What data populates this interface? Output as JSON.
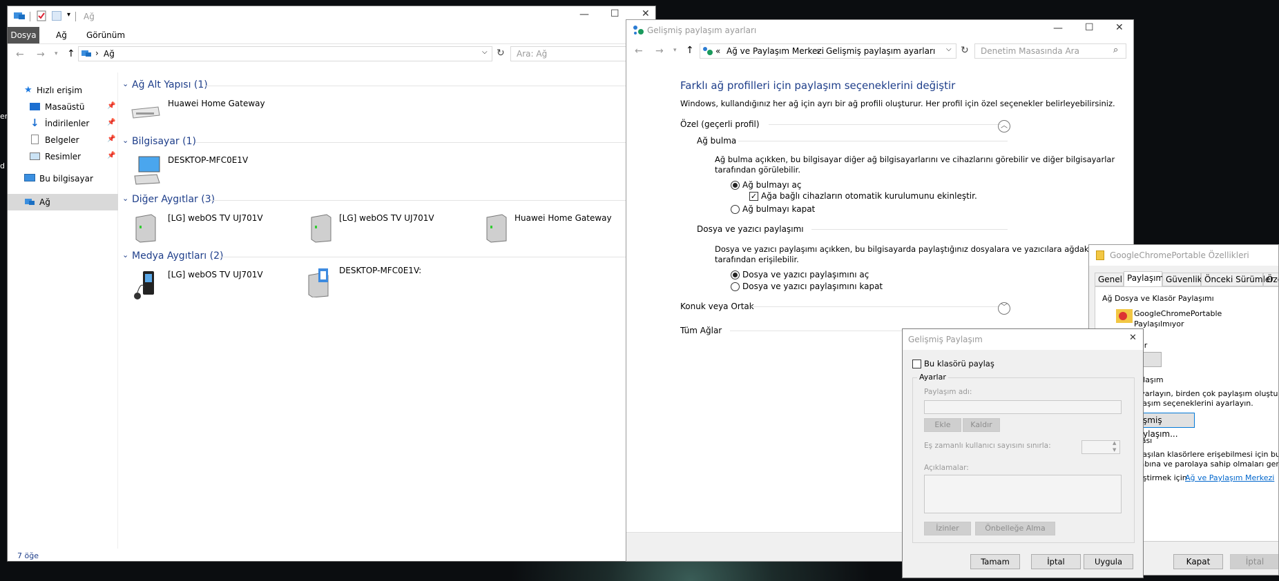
{
  "desktop": {
    "edge_glyphs": [
      "er",
      "d"
    ]
  },
  "explorer": {
    "title": "Ağ",
    "ribbon_tabs": [
      "Dosya",
      "Ağ",
      "Görünüm"
    ],
    "address": "Ağ",
    "search_placeholder": "Ara: Ağ",
    "nav": {
      "quick_access": "Hızlı erişim",
      "items": [
        "Masaüstü",
        "İndirilenler",
        "Belgeler",
        "Resimler"
      ],
      "this_pc": "Bu bilgisayar",
      "network": "Ağ"
    },
    "groups": [
      {
        "title": "Ağ Alt Yapısı (1)",
        "items": [
          "Huawei Home Gateway"
        ]
      },
      {
        "title": "Bilgisayar (1)",
        "items": [
          "DESKTOP-MFC0E1V"
        ]
      },
      {
        "title": "Diğer Aygıtlar (3)",
        "items": [
          "[LG] webOS TV UJ701V",
          "[LG] webOS TV UJ701V",
          "Huawei Home Gateway"
        ]
      },
      {
        "title": "Medya Aygıtları (2)",
        "items": [
          "[LG] webOS TV UJ701V",
          "DESKTOP-MFC0E1V:"
        ]
      }
    ],
    "status": "7 öğe"
  },
  "advanced": {
    "title": "Gelişmiş paylaşım ayarları",
    "breadcrumb_prefix": "«",
    "breadcrumb": [
      "Ağ ve Paylaşım Merkezi",
      "Gelişmiş paylaşım ayarları"
    ],
    "search_placeholder": "Denetim Masasında Ara",
    "heading": "Farklı ağ profilleri için paylaşım seçeneklerini değiştir",
    "intro": "Windows, kullandığınız her ağ için ayrı bir ağ profili oluşturur. Her profil için özel seçenekler belirleyebilirsiniz.",
    "profile_private": "Özel (geçerli profil)",
    "discovery_title": "Ağ bulma",
    "discovery_desc_1": "Ağ bulma açıkken, bu bilgisayar diğer ağ bilgisayarlarını ve cihazlarını görebilir ve diğer bilgisayarlar",
    "discovery_desc_2": "tarafından görülebilir.",
    "discovery_on": "Ağ bulmayı aç",
    "discovery_auto": "Ağa bağlı cihazların otomatik kurulumunu ekinleştir.",
    "discovery_off": "Ağ bulmayı kapat",
    "sharing_title": "Dosya ve yazıcı paylaşımı",
    "sharing_desc_1": "Dosya ve yazıcı paylaşımı açıkken, bu bilgisayarda paylaştığınız dosyalara ve yazıcılara ağdaki kişiler",
    "sharing_desc_2": "tarafından erişilebilir.",
    "sharing_on": "Dosya ve yazıcı paylaşımını aç",
    "sharing_off": "Dosya ve yazıcı paylaşımını kapat",
    "profile_guest": "Konuk veya Ortak",
    "profile_all": "Tüm Ağlar"
  },
  "props": {
    "title": "GoogleChromePortable Özellikleri",
    "tabs": [
      "Genel",
      "Paylaşım",
      "Güvenlik",
      "Önceki Sürümler",
      "Özel"
    ],
    "section_network": "Ağ Dosya ve Klasör Paylaşımı",
    "folder_name": "GoogleChromePortable",
    "folder_status": "Paylaşılmıyor",
    "frag_or": "or",
    "share_btn": "ı...",
    "frag_share_title": "aylaşım",
    "frag_desc_1": "ı ayarlayın, birden çok paylaşım oluşturun",
    "frag_desc_2": "aylaşım seçeneklerini ayarlayın.",
    "adv_btn": "elişmiş Paylaşım...",
    "frag_pw_title": "ması",
    "frag_pw_1": "aylaşılan klasörlere erişebilmesi için bu bilgis",
    "frag_pw_2": "esabına ve parolaya sahip olmaları gerekir.",
    "frag_pw_3": "eğiştirmek için",
    "pw_link": "Ağ ve Paylaşım Merkezi",
    "close_btn": "Kapat",
    "cancel_btn": "İptal"
  },
  "dialog": {
    "title": "Gelişmiş Paylaşım",
    "share_checkbox": "Bu klasörü paylaş",
    "settings_group": "Ayarlar",
    "share_name_label": "Paylaşım adı:",
    "add_btn": "Ekle",
    "remove_btn": "Kaldır",
    "limit_label": "Eş zamanlı kullanıcı sayısını sınırla:",
    "comments_label": "Açıklamalar:",
    "permissions_btn": "İzinler",
    "caching_btn": "Önbelleğe Alma",
    "ok_btn": "Tamam",
    "cancel_btn": "İptal",
    "apply_btn": "Uygula"
  }
}
